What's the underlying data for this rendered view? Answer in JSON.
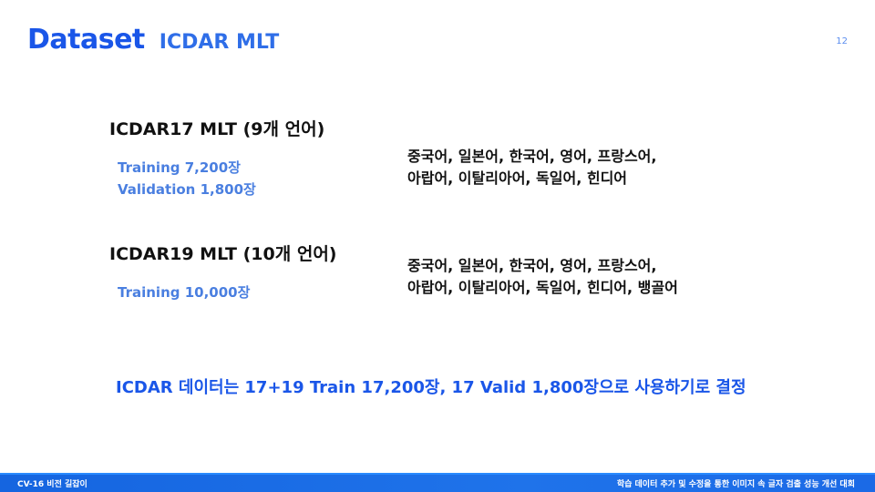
{
  "slide": {
    "title": "Dataset",
    "subtitle": "ICDAR MLT",
    "page_number": "12"
  },
  "sections": [
    {
      "heading": "ICDAR17 MLT (9개 언어)",
      "stats": [
        "Training 7,200장",
        "Validation 1,800장"
      ],
      "languages": [
        "중국어, 일본어, 한국어, 영어, 프랑스어,",
        "아랍어, 이탈리아어, 독일어, 힌디어"
      ]
    },
    {
      "heading": "ICDAR19 MLT (10개 언어)",
      "stats": [
        "Training 10,000장"
      ],
      "languages": [
        "중국어, 일본어, 한국어, 영어, 프랑스어,",
        "아랍어, 이탈리아어, 독일어, 힌디어, 뱅골어"
      ]
    }
  ],
  "conclusion": "ICDAR 데이터는 17+19 Train 17,200장, 17 Valid 1,800장으로 사용하기로 결정",
  "footer": {
    "left": "CV-16 비전 길잡이",
    "right": "학습 데이터 추가 및 수정을 통한 이미지 속 글자 검출 성능 개선 대회"
  },
  "colors": {
    "title_blue": "#1a56e8",
    "stat_blue": "#4a7fe0",
    "footer_blue": "#1565e0"
  }
}
